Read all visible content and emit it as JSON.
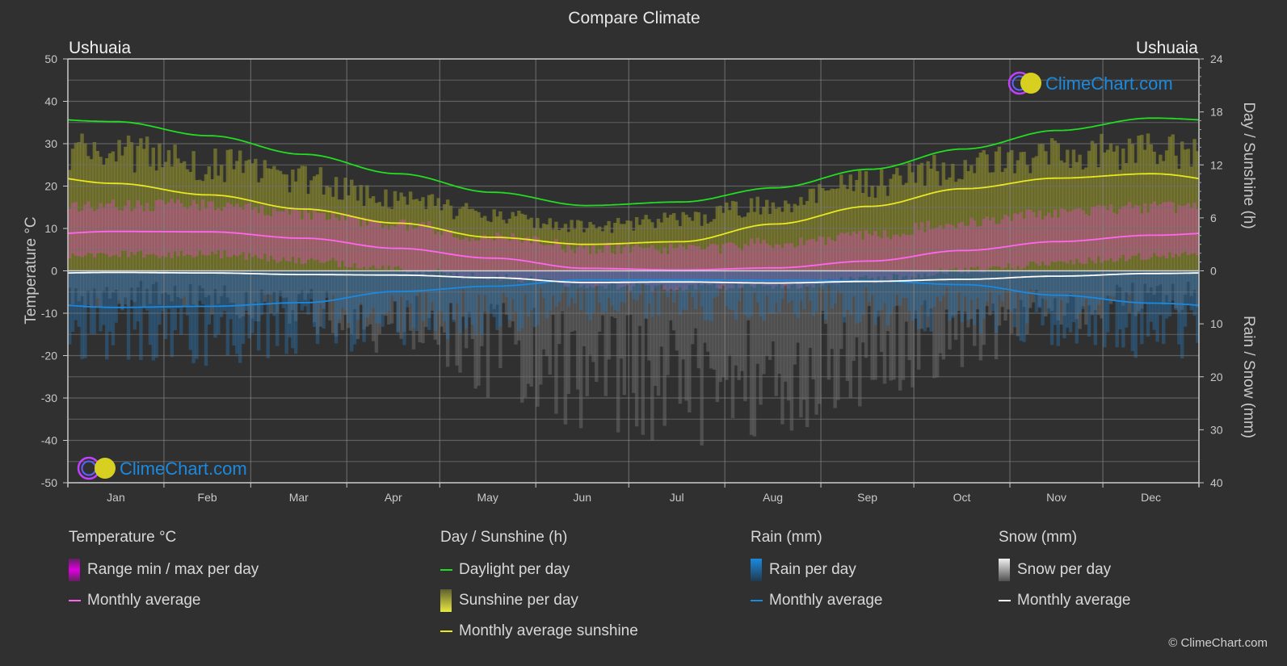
{
  "page": {
    "title": "Compare Climate",
    "location_left": "Ushuaia",
    "location_right": "Ushuaia",
    "watermark": "ClimeChart.com",
    "copyright": "© ClimeChart.com"
  },
  "legend": {
    "temperature": {
      "header": "Temperature °C",
      "items": [
        {
          "label": "Range min / max per day",
          "swatch": "box",
          "color": "#e000e0"
        },
        {
          "label": "Monthly average",
          "swatch": "line",
          "color": "#ff66ee"
        }
      ]
    },
    "sunshine": {
      "header": "Day / Sunshine (h)",
      "items": [
        {
          "label": "Daylight per day",
          "swatch": "line",
          "color": "#22dd22"
        },
        {
          "label": "Sunshine per day",
          "swatch": "box",
          "color": "#e8e840"
        },
        {
          "label": "Monthly average sunshine",
          "swatch": "line",
          "color": "#e8e820"
        }
      ]
    },
    "rain": {
      "header": "Rain (mm)",
      "items": [
        {
          "label": "Rain per day",
          "swatch": "box",
          "color": "#1a8ae0"
        },
        {
          "label": "Monthly average",
          "swatch": "line",
          "color": "#1a8ae0"
        }
      ]
    },
    "snow": {
      "header": "Snow (mm)",
      "items": [
        {
          "label": "Snow per day",
          "swatch": "box",
          "color": "#e0e0e0"
        },
        {
          "label": "Monthly average",
          "swatch": "line",
          "color": "#ffffff"
        }
      ]
    }
  },
  "chart_data": {
    "type": "line",
    "title": "Compare Climate",
    "categories": [
      "Jan",
      "Feb",
      "Mar",
      "Apr",
      "May",
      "Jun",
      "Jul",
      "Aug",
      "Sep",
      "Oct",
      "Nov",
      "Dec"
    ],
    "axes": {
      "left": {
        "label": "Temperature °C",
        "range": [
          -50,
          50
        ],
        "ticks": [
          50,
          40,
          30,
          20,
          10,
          0,
          -10,
          -20,
          -30,
          -40,
          -50
        ]
      },
      "right_top": {
        "label": "Day / Sunshine (h)",
        "range": [
          0,
          24
        ],
        "ticks": [
          24,
          18,
          12,
          6,
          0
        ]
      },
      "right_bottom": {
        "label": "Rain / Snow (mm)",
        "range": [
          0,
          40
        ],
        "ticks": [
          0,
          10,
          20,
          30,
          40
        ]
      }
    },
    "grid": true,
    "series": [
      {
        "name": "Daylight per day",
        "unit": "h",
        "color": "#22dd22",
        "values": [
          16.9,
          15.3,
          13.2,
          11.0,
          8.9,
          7.4,
          7.8,
          9.4,
          11.5,
          13.8,
          15.9,
          17.3
        ]
      },
      {
        "name": "Monthly average sunshine",
        "unit": "h",
        "color": "#e8e820",
        "values": [
          9.9,
          8.6,
          7.0,
          5.4,
          3.8,
          3.0,
          3.3,
          5.3,
          7.3,
          9.3,
          10.5,
          11.0
        ]
      },
      {
        "name": "Temperature monthly average",
        "unit": "°C",
        "color": "#ff66ee",
        "values": [
          9.3,
          9.2,
          7.7,
          5.3,
          3.0,
          0.6,
          0.2,
          0.7,
          2.3,
          4.8,
          6.9,
          8.4
        ]
      },
      {
        "name": "Rain monthly average",
        "unit": "mm",
        "color": "#1a8ae0",
        "values": [
          6.9,
          6.7,
          6.0,
          3.9,
          2.9,
          1.7,
          1.7,
          1.8,
          1.9,
          2.6,
          4.6,
          6.1
        ]
      },
      {
        "name": "Snow monthly average",
        "unit": "mm",
        "color": "#ffffff",
        "values": [
          0.3,
          0.4,
          0.7,
          0.8,
          1.3,
          2.2,
          2.1,
          2.3,
          2.0,
          1.6,
          1.0,
          0.5
        ]
      }
    ],
    "daily_bands": {
      "sunshine_per_day_h": {
        "typical_max": [
          15.0,
          13.5,
          11.5,
          9.0,
          7.0,
          5.5,
          6.5,
          8.5,
          11.0,
          13.0,
          14.5,
          15.5
        ]
      },
      "temperature_range_c": {
        "min": [
          5.0,
          5.0,
          3.5,
          1.5,
          -0.5,
          -2.5,
          -3.0,
          -2.5,
          -1.0,
          1.0,
          3.0,
          4.5
        ],
        "max": [
          14.0,
          14.0,
          12.0,
          9.5,
          6.5,
          4.0,
          3.5,
          5.0,
          7.0,
          10.0,
          12.0,
          13.5
        ]
      },
      "rain_per_day_mm": {
        "typical_max": [
          15,
          15,
          14,
          12,
          10,
          8,
          8,
          8,
          9,
          10,
          12,
          14
        ]
      },
      "snow_per_day_mm": {
        "typical_max": [
          6,
          7,
          10,
          14,
          20,
          26,
          28,
          26,
          22,
          16,
          10,
          7
        ]
      }
    }
  }
}
